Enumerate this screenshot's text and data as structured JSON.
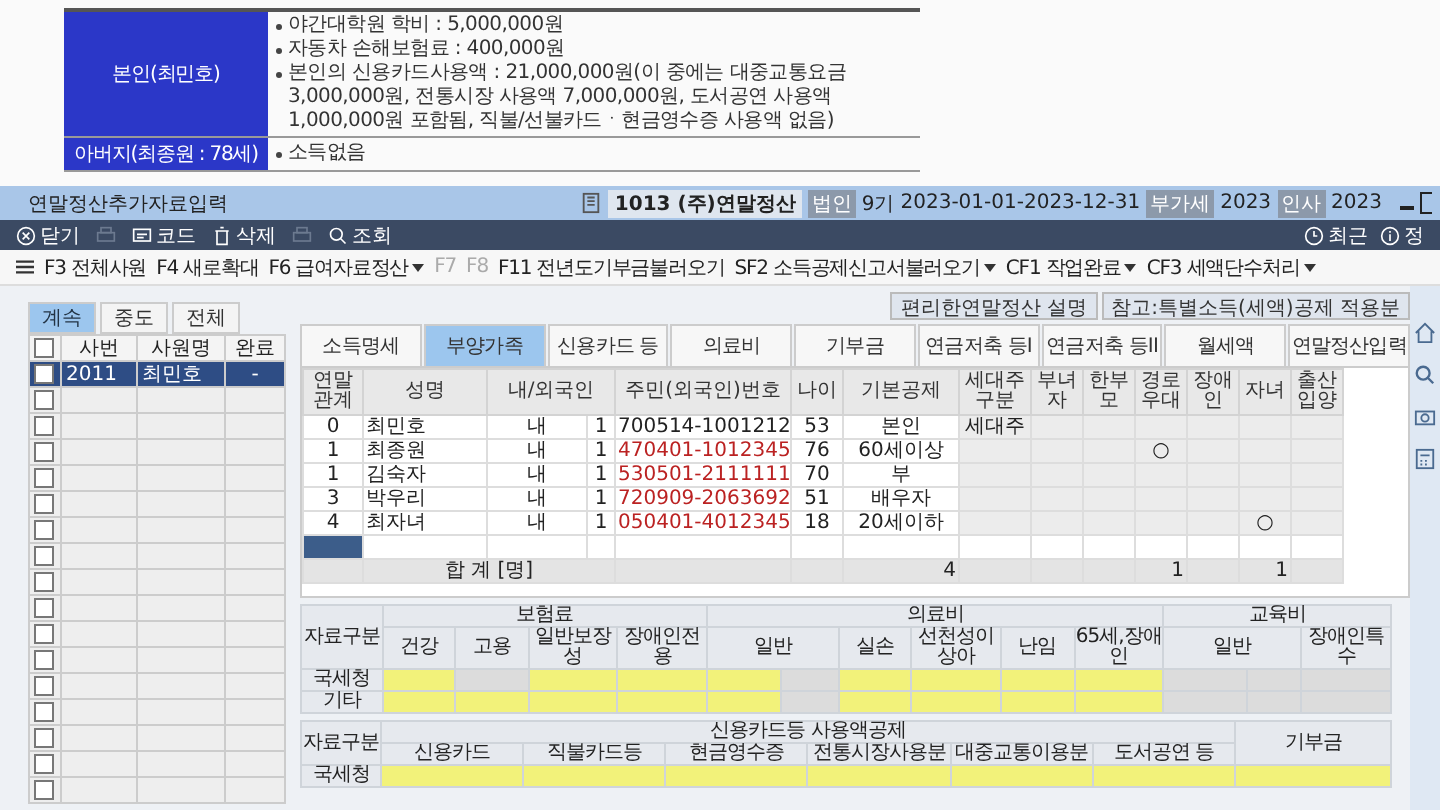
{
  "document": {
    "rows": [
      {
        "label": "본인(최민호)",
        "items": [
          "야간대학원 학비 : 5,000,000원",
          "자동차 손해보험료 : 400,000원",
          "본인의 신용카드사용액 : 21,000,000원(이 중에는 대중교통요금 3,000,000원, 전통시장 사용액 7,000,000원, 도서공연 사용액 1,000,000원 포함됨, 직불/선불카드ㆍ현금영수증 사용액 없음)"
        ]
      },
      {
        "label": "아버지(최종원 : 78세)",
        "items": [
          "소득없음"
        ]
      }
    ]
  },
  "window": {
    "title": "연말정산추가자료입력",
    "company": "1013 (주)연말정산",
    "badges": [
      {
        "kind": "tag",
        "text": "법인"
      },
      {
        "kind": "value",
        "text": "9기"
      },
      {
        "kind": "value",
        "text": "2023-01-01-2023-12-31"
      },
      {
        "kind": "tag",
        "text": "부가세"
      },
      {
        "kind": "value",
        "text": "2023"
      },
      {
        "kind": "tag",
        "text": "인사"
      },
      {
        "kind": "value",
        "text": "2023"
      }
    ]
  },
  "toolbar": [
    {
      "label": "닫기",
      "disabled": false
    },
    {
      "disabled": true
    },
    {
      "label": "코드",
      "disabled": false
    },
    {
      "label": "삭제",
      "disabled": false
    },
    {
      "disabled": true
    },
    {
      "label": "조회",
      "disabled": false
    }
  ],
  "toolbar_right": [
    "최근",
    "정"
  ],
  "function_bar": [
    {
      "key": "F3",
      "label": "전체사원",
      "disabled": false,
      "dropdown": false
    },
    {
      "key": "F4",
      "label": "새로확대",
      "disabled": false,
      "dropdown": false
    },
    {
      "key": "F6",
      "label": "급여자료정산",
      "disabled": false,
      "dropdown": true
    },
    {
      "key": "F7",
      "disabled": true,
      "dropdown": false
    },
    {
      "key": "F8",
      "disabled": true,
      "dropdown": false
    },
    {
      "key": "F11",
      "label": "전년도기부금불러오기",
      "disabled": false,
      "dropdown": false
    },
    {
      "key": "SF2",
      "label": "소득공제신고서불러오기",
      "disabled": false,
      "dropdown": true
    },
    {
      "key": "CF1",
      "label": "작업완료",
      "disabled": false,
      "dropdown": true
    },
    {
      "key": "CF3",
      "label": "세액단수처리",
      "disabled": false,
      "dropdown": true
    }
  ],
  "employee_tabs": [
    {
      "label": "계속",
      "selected": true
    },
    {
      "label": "중도",
      "selected": false
    },
    {
      "label": "전체",
      "selected": false
    }
  ],
  "employee_table": {
    "all_checked": false,
    "columns": [
      "사번",
      "사원명",
      "완료"
    ],
    "rows": [
      {
        "number": "2011",
        "name": "최민호",
        "done": "-",
        "checked": false,
        "selected": true
      },
      {
        "checked": false,
        "selected": false
      },
      {
        "checked": false,
        "selected": false
      },
      {
        "checked": false,
        "selected": false
      },
      {
        "checked": false,
        "selected": false
      },
      {
        "checked": false,
        "selected": false
      },
      {
        "checked": false,
        "selected": false
      },
      {
        "checked": false,
        "selected": false
      },
      {
        "checked": false,
        "selected": false
      },
      {
        "checked": false,
        "selected": false
      },
      {
        "checked": false,
        "selected": false
      },
      {
        "checked": false,
        "selected": false
      },
      {
        "checked": false,
        "selected": false
      },
      {
        "checked": false,
        "selected": false
      },
      {
        "checked": false,
        "selected": false
      },
      {
        "checked": false,
        "selected": false
      },
      {
        "checked": false,
        "selected": false
      }
    ]
  },
  "links": [
    "편리한연말정산 설명",
    "참고:특별소득(세액)공제 적용분"
  ],
  "tabs": [
    {
      "label": "소득명세",
      "selected": false
    },
    {
      "label": "부양가족",
      "selected": true
    },
    {
      "label": "신용카드 등",
      "selected": false
    },
    {
      "label": "의료비",
      "selected": false
    },
    {
      "label": "기부금",
      "selected": false
    },
    {
      "label": "연금저축 등I",
      "selected": false
    },
    {
      "label": "연금저축 등II",
      "selected": false
    },
    {
      "label": "월세액",
      "selected": false
    },
    {
      "label": "연말정산입력",
      "selected": false
    }
  ],
  "dependents": {
    "columns": [
      {
        "label": "연말관계"
      },
      {
        "label": "성명"
      },
      {
        "label": "내/외국인",
        "colspan": 2
      },
      {
        "label": "주민(외국인)번호"
      },
      {
        "label": "나이"
      },
      {
        "label": "기본공제"
      },
      {
        "label": "세대주구분"
      },
      {
        "label": "부녀자"
      },
      {
        "label": "한부모"
      },
      {
        "label": "경로우대"
      },
      {
        "label": "장애인"
      },
      {
        "label": "자녀"
      },
      {
        "label": "출산입양"
      }
    ],
    "rows": [
      {
        "cells": [
          "0",
          "최민호",
          "내",
          "1",
          "700514-1001212",
          "53",
          "본인",
          "세대주",
          null,
          null,
          null,
          null,
          null,
          null
        ],
        "id_flagged": false
      },
      {
        "cells": [
          "1",
          "최종원",
          "내",
          "1",
          "470401-1012345",
          "76",
          "60세이상",
          null,
          null,
          null,
          "○",
          null,
          null,
          null
        ],
        "id_flagged": true
      },
      {
        "cells": [
          "1",
          "김숙자",
          "내",
          "1",
          "530501-2111111",
          "70",
          "부",
          null,
          null,
          null,
          null,
          null,
          null,
          null
        ],
        "id_flagged": true
      },
      {
        "cells": [
          "3",
          "박우리",
          "내",
          "1",
          "720909-2063692",
          "51",
          "배우자",
          null,
          null,
          null,
          null,
          null,
          null,
          null
        ],
        "id_flagged": true
      },
      {
        "cells": [
          "4",
          "최자녀",
          "내",
          "1",
          "050401-4012345",
          "18",
          "20세이하",
          null,
          null,
          null,
          null,
          null,
          "○",
          null
        ],
        "id_flagged": true
      }
    ],
    "blank_row_selected": true,
    "total_label": "합   계 [명]",
    "totals": {
      "basic": "4",
      "elderly": "1",
      "child": "1"
    }
  },
  "deduction_table": {
    "row_header": "자료구분",
    "groups": [
      {
        "label": "보험료",
        "columns": [
          {
            "label": "건강",
            "double": false
          },
          {
            "label": "고용",
            "double": false
          },
          {
            "label": "일반보장성",
            "double": false
          },
          {
            "label": "장애인전용",
            "double": false
          }
        ]
      },
      {
        "label": "의료비",
        "columns": [
          {
            "label": "일반",
            "double": true
          },
          {
            "label": "실손",
            "double": false
          },
          {
            "label": "선천성이상아",
            "double": false
          },
          {
            "label": "난임",
            "double": false
          },
          {
            "label": "65세,장애인",
            "double": false
          }
        ]
      },
      {
        "label": "교육비",
        "columns": [
          {
            "label": "일반",
            "double": true
          },
          {
            "label": "장애인특수",
            "double": false
          }
        ]
      }
    ],
    "rows": [
      {
        "label": "국세청",
        "editable": [
          true,
          false,
          true,
          true,
          true,
          false,
          true,
          true,
          true,
          true,
          false,
          false,
          false
        ]
      },
      {
        "label": "기타",
        "editable": [
          true,
          true,
          true,
          true,
          true,
          false,
          true,
          true,
          true,
          true,
          false,
          false,
          false
        ]
      }
    ]
  },
  "card_table": {
    "row_header": "자료구분",
    "group": "신용카드등 사용액공제",
    "columns": [
      "신용카드",
      "직불카드등",
      "현금영수증",
      "전통시장사용분",
      "대중교통이용분",
      "도서공연 등"
    ],
    "extra": "기부금",
    "rows": [
      {
        "label": "국세청",
        "editable": [
          true,
          true,
          true,
          true,
          true,
          true,
          true
        ]
      }
    ]
  }
}
